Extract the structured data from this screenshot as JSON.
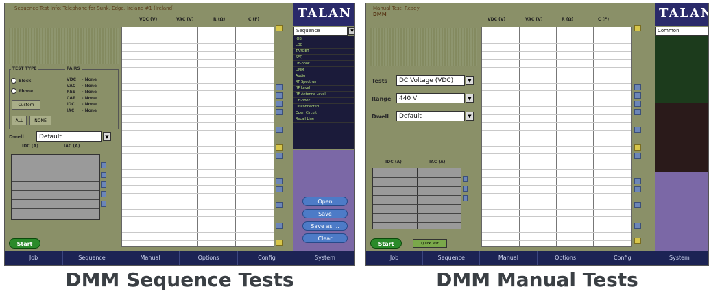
{
  "left": {
    "status_text": "Sequence Test Info: Telephone for Sunk, Edge, Ireland #1 (Ireland)",
    "columns": [
      "VDC (V)",
      "VAC (V)",
      "R (Ω)",
      "C (F)"
    ],
    "test_type_title": "TEST TYPE",
    "pairs_title": "PAIRS",
    "radio_options": [
      "Block",
      "Phone"
    ],
    "custom_label": "Custom",
    "all_label": "ALL",
    "none_label": "NONE",
    "pairs": [
      {
        "name": "VDC",
        "value": "- None"
      },
      {
        "name": "VAC",
        "value": "- None"
      },
      {
        "name": "RES",
        "value": "- None"
      },
      {
        "name": "CAP",
        "value": "- None"
      },
      {
        "name": "IDC",
        "value": "- None"
      },
      {
        "name": "IAC",
        "value": "- None"
      }
    ],
    "dwell_label": "Dwell",
    "dwell_value": "Default",
    "small_columns": [
      "IDC (A)",
      "IAC (A)"
    ],
    "sidebar_select": "Sequence",
    "info_lines": [
      "JOB",
      "LOC",
      "TARGET",
      "SEQ",
      "Un-book",
      "DMM",
      "Audio",
      "RF Spectrum",
      "RF Level",
      "RF Antenna Level",
      "Off-hook",
      "Disconnected",
      "Open Circuit",
      "Recall Line"
    ],
    "buttons": [
      "Open",
      "Save",
      "Save as ...",
      "Clear"
    ],
    "start_label": "Start",
    "caption": "DMM Sequence Tests"
  },
  "right": {
    "status_text": "Manual Test: Ready",
    "status_sub": "DMM",
    "columns": [
      "VDC (V)",
      "VAC (V)",
      "R (Ω)",
      "C (F)"
    ],
    "tests_label": "Tests",
    "tests_value": "DC Voltage (VDC)",
    "range_label": "Range",
    "range_value": "440 V",
    "dwell_label": "Dwell",
    "dwell_value": "Default",
    "small_columns": [
      "IDC (A)",
      "IAC (A)"
    ],
    "sidebar_select": "Common",
    "start_label": "Start",
    "quick_test_label": "Quick Test",
    "caption": "DMM Manual Tests"
  },
  "brand_text": "TALAN",
  "tabs": [
    "Job",
    "Sequence",
    "Manual",
    "Options",
    "Config",
    "System"
  ],
  "colors": {
    "panel": "#8a9068",
    "navbar": "#1c2354",
    "accent_blue": "#4d7bc7",
    "start_green": "#2a8a2a",
    "purple": "#7b68a6"
  }
}
